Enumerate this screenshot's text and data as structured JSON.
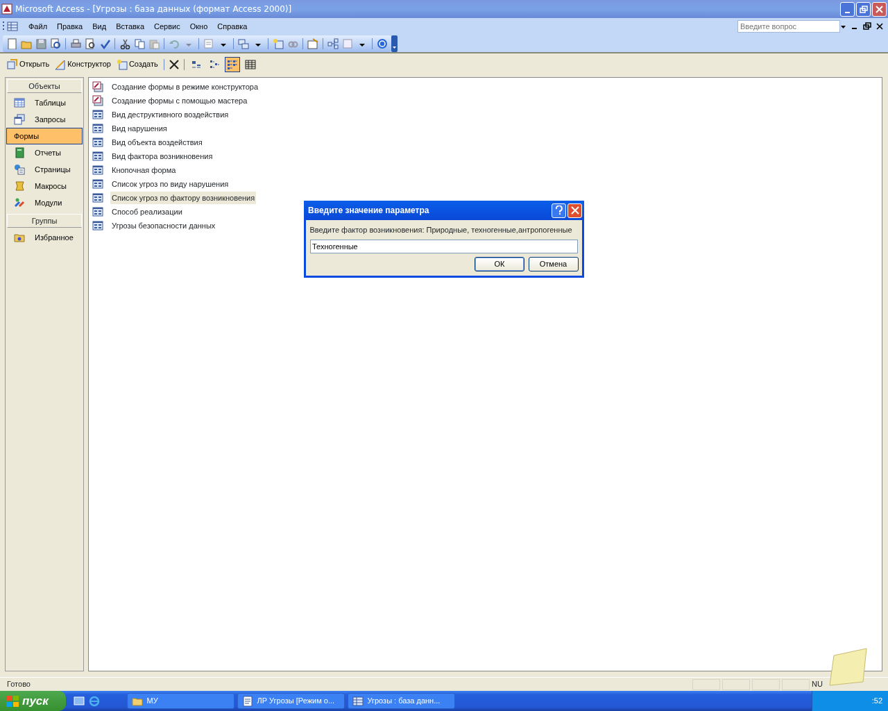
{
  "window": {
    "title": "Microsoft Access - [Угрозы : база данных (формат Access 2000)]"
  },
  "menu": [
    "Файл",
    "Правка",
    "Вид",
    "Вставка",
    "Сервис",
    "Окно",
    "Справка"
  ],
  "help_box": {
    "placeholder": "Введите вопрос"
  },
  "db_toolbar": {
    "buttons": [
      {
        "label": "Открыть",
        "kind": "open"
      },
      {
        "label": "Конструктор",
        "kind": "design"
      },
      {
        "label": "Создать",
        "kind": "new"
      }
    ],
    "views": [
      {
        "kind": "large",
        "selected": false
      },
      {
        "kind": "small",
        "selected": false
      },
      {
        "kind": "list",
        "selected": true
      },
      {
        "kind": "details",
        "selected": false
      }
    ]
  },
  "objects": {
    "header": "Объекты",
    "items": [
      {
        "label": "Таблицы",
        "kind": "tables",
        "selected": false
      },
      {
        "label": "Запросы",
        "kind": "queries",
        "selected": false
      },
      {
        "label": "Формы",
        "kind": "forms",
        "selected": true
      },
      {
        "label": "Отчеты",
        "kind": "reports",
        "selected": false
      },
      {
        "label": "Страницы",
        "kind": "pages",
        "selected": false
      },
      {
        "label": "Макросы",
        "kind": "macros",
        "selected": false
      },
      {
        "label": "Модули",
        "kind": "modules",
        "selected": false
      }
    ]
  },
  "groups": {
    "header": "Группы",
    "items": [
      {
        "label": "Избранное",
        "kind": "favorites",
        "selected": false
      }
    ]
  },
  "list": [
    {
      "label": "Создание формы в режиме конструктора",
      "kind": "wizard",
      "selected": false
    },
    {
      "label": "Создание формы с помощью мастера",
      "kind": "wizard",
      "selected": false
    },
    {
      "label": "Вид деструктивного воздействия",
      "kind": "form",
      "selected": false
    },
    {
      "label": "Вид нарушения",
      "kind": "form",
      "selected": false
    },
    {
      "label": "Вид объекта воздействия",
      "kind": "form",
      "selected": false
    },
    {
      "label": "Вид фактора возникновения",
      "kind": "form",
      "selected": false
    },
    {
      "label": "Кнопочная форма",
      "kind": "form",
      "selected": false
    },
    {
      "label": "Список угроз по виду нарушения",
      "kind": "form",
      "selected": false
    },
    {
      "label": "Список угроз по фактору возникновения",
      "kind": "form",
      "selected": true
    },
    {
      "label": "Способ реализации",
      "kind": "form",
      "selected": false
    },
    {
      "label": "Угрозы безопасности данных",
      "kind": "form",
      "selected": false
    }
  ],
  "dialog": {
    "title": "Введите значение параметра",
    "prompt": "Введите фактор возникновения: Природные, техногенные,антропогенные",
    "value": "Техногенные",
    "buttons": [
      "ОК",
      "Отмена"
    ]
  },
  "status_bar": {
    "text": "Готово",
    "indicator": "NU"
  },
  "taskbar": {
    "start": "пуск",
    "tasks": [
      {
        "label": "МУ",
        "kind": "folder",
        "selected": false
      },
      {
        "label": "ЛР Угрозы [Режим о...",
        "kind": "document",
        "selected": false
      },
      {
        "label": "Угрозы : база данн...",
        "kind": "database",
        "selected": false
      }
    ],
    "clock": ":52"
  }
}
